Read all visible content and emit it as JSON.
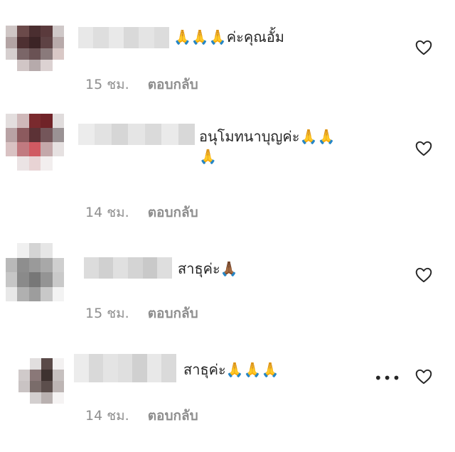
{
  "comments": [
    {
      "text": "🙏🙏🙏ค่ะคุณอั้ม",
      "time": "15 ชม.",
      "reply": "ตอบกลับ",
      "liked": false
    },
    {
      "text": "อนุโมทนาบุญค่ะ🙏🙏\n🙏",
      "time": "14 ชม.",
      "reply": "ตอบกลับ",
      "liked": false
    },
    {
      "text": "สาธุค่ะ🙏🏾",
      "time": "15 ชม.",
      "reply": "ตอบกลับ",
      "liked": false
    },
    {
      "text": "สาธุค่ะ🙏🙏🙏",
      "time": "14 ชม.",
      "reply": "ตอบกลับ",
      "liked": false,
      "more": "•••"
    }
  ],
  "icons": {
    "like": "heart-outline-icon",
    "more": "more-options-icon"
  },
  "colors": {
    "text": "#262626",
    "secondary": "#8e8e8e",
    "background": "#ffffff"
  }
}
